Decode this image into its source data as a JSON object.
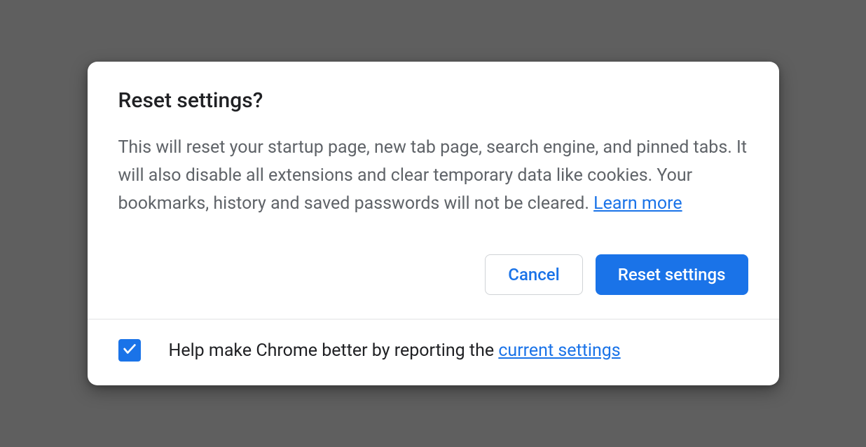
{
  "dialog": {
    "title": "Reset settings?",
    "body": "This will reset your startup page, new tab page, search engine, and pinned tabs. It will also disable all extensions and clear temporary data like cookies. Your bookmarks, history and saved passwords will not be cleared.",
    "learn_more": " Learn more",
    "actions": {
      "cancel": "Cancel",
      "confirm": "Reset settings"
    },
    "footer": {
      "checkbox_checked": true,
      "text": "Help make Chrome better by reporting the ",
      "link": "current settings"
    }
  }
}
